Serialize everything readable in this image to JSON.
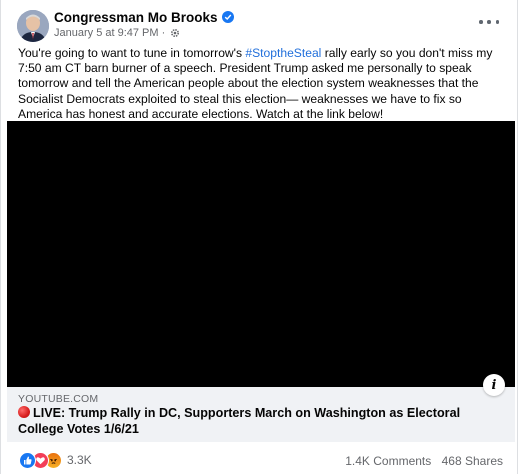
{
  "post": {
    "author": "Congressman Mo Brooks",
    "timestamp": "January 5 at 9:47 PM",
    "separator": "·",
    "text_before": "You're going to want to tune in tomorrow's ",
    "hashtag": "#StoptheSteal",
    "text_after": " rally early so you don't miss my 7:50 am CT barn burner of a speech. President Trump asked me personally to speak tomorrow and tell the American people about the election system weaknesses that the Socialist Democrats exploited to steal this election— weaknesses we have to fix so America has honest and accurate elections. Watch at the link below!"
  },
  "link_preview": {
    "source": "YOUTUBE.COM",
    "title": "LIVE: Trump Rally in DC, Supporters March on Washington as Electoral College Votes 1/6/21",
    "info_label": "i"
  },
  "footer": {
    "reactions": [
      "like-icon",
      "love-icon",
      "angry-icon"
    ],
    "reaction_count": "3.3K",
    "comments": "1.4K Comments",
    "shares": "468 Shares"
  },
  "colors": {
    "accent": "#1877f2",
    "hashtag": "#216fdb",
    "muted": "#65676b",
    "link_bg": "#f0f2f5"
  }
}
